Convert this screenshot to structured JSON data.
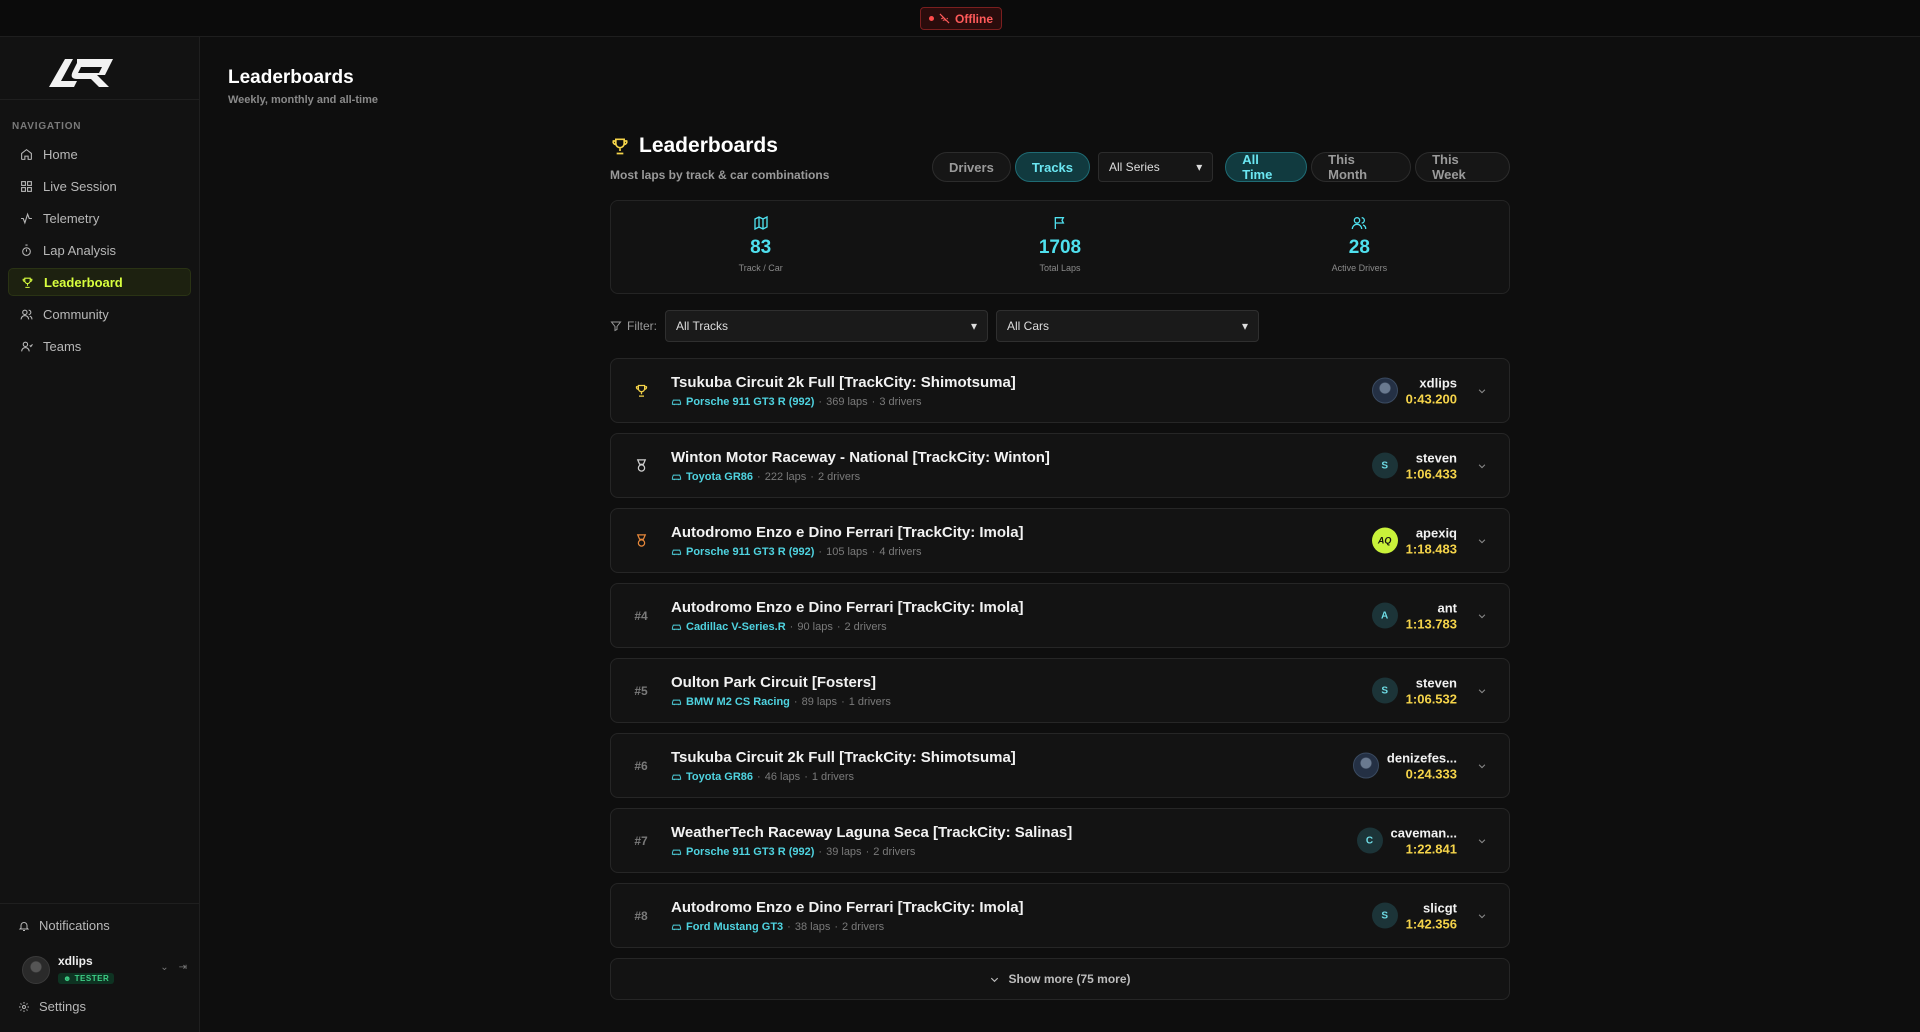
{
  "status": {
    "label": "Offline"
  },
  "sidebar": {
    "logo_text": "AQ",
    "nav_heading": "NAVIGATION",
    "items": [
      {
        "label": "Home",
        "icon": "home-icon"
      },
      {
        "label": "Live Session",
        "icon": "grid-icon"
      },
      {
        "label": "Telemetry",
        "icon": "activity-icon"
      },
      {
        "label": "Lap Analysis",
        "icon": "timer-icon"
      },
      {
        "label": "Leaderboard",
        "icon": "trophy-icon",
        "active": true
      },
      {
        "label": "Community",
        "icon": "users-icon"
      },
      {
        "label": "Teams",
        "icon": "team-icon"
      }
    ],
    "notifications_label": "Notifications",
    "user": {
      "name": "xdlips",
      "badge": "TESTER"
    },
    "settings_label": "Settings"
  },
  "page": {
    "title": "Leaderboards",
    "subtitle": "Weekly, monthly and all-time"
  },
  "leaderboard": {
    "title": "Leaderboards",
    "subtitle": "Most laps by track & car combinations",
    "tabs": [
      "Drivers",
      "Tracks"
    ],
    "active_tab": "Tracks",
    "series_select": "All Series",
    "periods": [
      "All Time",
      "This Month",
      "This Week"
    ],
    "active_period": "All Time",
    "stats": [
      {
        "value": "83",
        "label": "Track / Car",
        "icon": "map-icon"
      },
      {
        "value": "1708",
        "label": "Total Laps",
        "icon": "flag-icon"
      },
      {
        "value": "28",
        "label": "Active Drivers",
        "icon": "users-icon"
      }
    ],
    "filter_label": "Filter:",
    "track_filter": "All Tracks",
    "car_filter": "All Cars",
    "rows": [
      {
        "rank": "",
        "rank_icon": "gold-trophy-icon",
        "track": "Tsukuba Circuit 2k Full [TrackCity: Shimotsuma]",
        "car": "Porsche 911 GT3 R (992)",
        "laps": "369 laps",
        "drivers": "3 drivers",
        "driver": "xdlips",
        "time": "0:43.200",
        "avatar": ""
      },
      {
        "rank": "",
        "rank_icon": "silver-medal-icon",
        "track": "Winton Motor Raceway - National [TrackCity: Winton]",
        "car": "Toyota GR86",
        "laps": "222 laps",
        "drivers": "2 drivers",
        "driver": "steven",
        "time": "1:06.433",
        "avatar": "S"
      },
      {
        "rank": "",
        "rank_icon": "bronze-medal-icon",
        "track": "Autodromo Enzo e Dino Ferrari [TrackCity: Imola]",
        "car": "Porsche 911 GT3 R (992)",
        "laps": "105 laps",
        "drivers": "4 drivers",
        "driver": "apexiq",
        "time": "1:18.483",
        "avatar": "AQ"
      },
      {
        "rank": "#4",
        "rank_icon": "",
        "track": "Autodromo Enzo e Dino Ferrari [TrackCity: Imola]",
        "car": "Cadillac V-Series.R",
        "laps": "90 laps",
        "drivers": "2 drivers",
        "driver": "ant",
        "time": "1:13.783",
        "avatar": "A"
      },
      {
        "rank": "#5",
        "rank_icon": "",
        "track": "Oulton Park Circuit [Fosters]",
        "car": "BMW M2 CS Racing",
        "laps": "89 laps",
        "drivers": "1 drivers",
        "driver": "steven",
        "time": "1:06.532",
        "avatar": "S"
      },
      {
        "rank": "#6",
        "rank_icon": "",
        "track": "Tsukuba Circuit 2k Full [TrackCity: Shimotsuma]",
        "car": "Toyota GR86",
        "laps": "46 laps",
        "drivers": "1 drivers",
        "driver": "denizefes...",
        "time": "0:24.333",
        "avatar": ""
      },
      {
        "rank": "#7",
        "rank_icon": "",
        "track": "WeatherTech Raceway Laguna Seca [TrackCity: Salinas]",
        "car": "Porsche 911 GT3 R (992)",
        "laps": "39 laps",
        "drivers": "2 drivers",
        "driver": "caveman...",
        "time": "1:22.841",
        "avatar": "C"
      },
      {
        "rank": "#8",
        "rank_icon": "",
        "track": "Autodromo Enzo e Dino Ferrari [TrackCity: Imola]",
        "car": "Ford Mustang GT3",
        "laps": "38 laps",
        "drivers": "2 drivers",
        "driver": "slicgt",
        "time": "1:42.356",
        "avatar": "S"
      }
    ],
    "show_more": "Show more (75 more)"
  },
  "colors": {
    "accent": "#d8ff3e",
    "cyan": "#4fe0ee",
    "gold": "#f5d44a",
    "offline": "#ff5a5a"
  }
}
